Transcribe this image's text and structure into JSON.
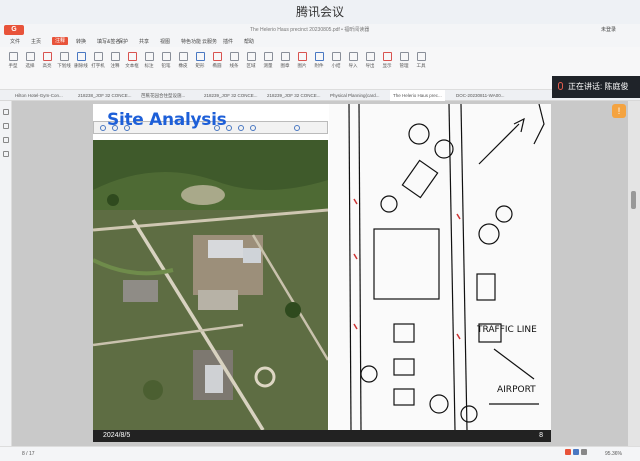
{
  "meeting": {
    "title": "腾讯会议"
  },
  "app": {
    "logo": "G",
    "doc_title": "The Helerio Haus precinct 20230805.pdf • 福昕阅读器",
    "login": "未登录"
  },
  "menu": [
    "文件",
    "主页",
    "注释",
    "转换",
    "填写&签名",
    "保护",
    "共享",
    "视图",
    "特色功能",
    "云服务",
    "插件",
    "帮助"
  ],
  "menu_active": 2,
  "ribbon": [
    {
      "label": "手型"
    },
    {
      "label": "选择"
    },
    {
      "label": "高亮"
    },
    {
      "label": "下划线"
    },
    {
      "label": "删除线"
    },
    {
      "label": "打字机"
    },
    {
      "label": "注释"
    },
    {
      "label": "文本框"
    },
    {
      "label": "标注"
    },
    {
      "label": "铅笔"
    },
    {
      "label": "橡皮"
    },
    {
      "label": "矩形"
    },
    {
      "label": "椭圆"
    },
    {
      "label": "线条"
    },
    {
      "label": "区域"
    },
    {
      "label": "测量"
    },
    {
      "label": "图章"
    },
    {
      "label": "图片"
    },
    {
      "label": "附件"
    },
    {
      "label": "小结"
    },
    {
      "label": "导入"
    },
    {
      "label": "导出"
    },
    {
      "label": "显示"
    },
    {
      "label": "管理"
    },
    {
      "label": "工具"
    }
  ],
  "tabs": [
    "Hilton Hotel-Gym-Con...",
    "218238_JOF 32 CONCE...",
    "芭蕉花园合住型设施...",
    "218239_JOF 32 CONCE...",
    "218239_JOF 32 CONCE...",
    "Physical Planning(card...",
    "The Helerio Haus prec...",
    "DOC-20230811-WA00..."
  ],
  "current_tab": 6,
  "slide": {
    "title": "Site Analysis",
    "date": "2024/8/5",
    "page": "8"
  },
  "sketch_labels": {
    "traffic": "TRAFFIC LINE",
    "airport": "AIRPORT"
  },
  "speaker": {
    "text": "正在讲话: 陈庭俊"
  },
  "status": {
    "page_indicator": "8 / 17",
    "zoom": "95.36%"
  },
  "icons": {
    "hand": "hand-icon",
    "mic": "mic-icon",
    "logo": "app-logo-icon"
  }
}
